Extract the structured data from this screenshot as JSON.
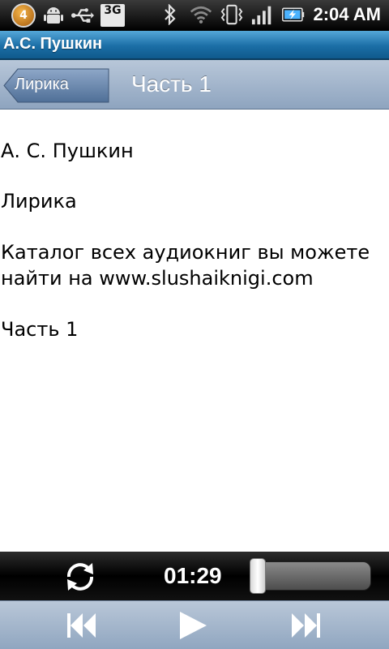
{
  "status_bar": {
    "notification_count": "4",
    "network": "3G",
    "time": "2:04 AM",
    "icons": [
      "notification-badge",
      "android-icon",
      "usb-icon",
      "3g-icon",
      "bluetooth-icon",
      "wifi-icon",
      "vibrate-icon",
      "signal-icon",
      "battery-charging-icon"
    ]
  },
  "app": {
    "title": "А.С. Пушкин"
  },
  "nav": {
    "back_label": "Лирика",
    "title": "Часть 1"
  },
  "content": {
    "author": "А. С. Пушкин",
    "collection": "Лирика",
    "catalog_text": "Каталог всех аудиокниг вы можете найти на www.slushaiknigi.com",
    "part": "Часть 1"
  },
  "player": {
    "elapsed": "01:29",
    "progress_fraction": 0.0,
    "icons": [
      "repeat-icon",
      "previous-icon",
      "play-icon",
      "next-icon"
    ]
  },
  "colors": {
    "title_bar": "#1b6ea6",
    "nav_bar": "#9fb3cb",
    "player_bar": "#000000"
  }
}
